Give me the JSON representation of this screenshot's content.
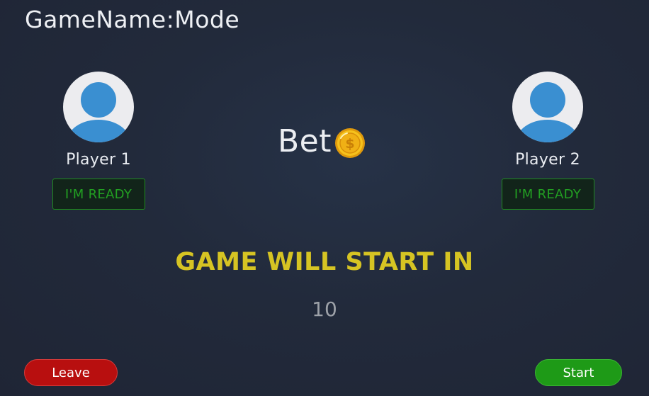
{
  "header": {
    "title": "GameName:Mode"
  },
  "players": [
    {
      "name": "Player 1",
      "ready_label": "I'M READY",
      "avatar_icon": "user-avatar-icon"
    },
    {
      "name": "Player 2",
      "ready_label": "I'M READY",
      "avatar_icon": "user-avatar-icon"
    }
  ],
  "bet": {
    "label": "Bet",
    "icon": "gold-coin-icon"
  },
  "countdown": {
    "heading": "GAME WILL START IN",
    "value": "10"
  },
  "actions": {
    "leave_label": "Leave",
    "start_label": "Start"
  },
  "colors": {
    "ready_text": "#22a022",
    "heading": "#d6c423",
    "leave": "#b80f0f",
    "start": "#1e9a17",
    "avatar_blue": "#3a8fd1"
  }
}
